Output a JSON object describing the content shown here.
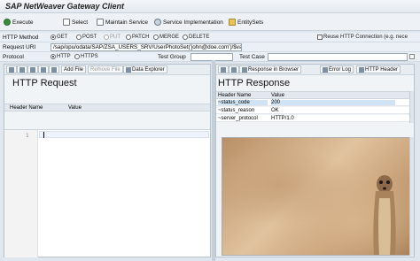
{
  "title": "SAP NetWeaver Gateway Client",
  "toolbar": {
    "execute": "Execute",
    "select": "Select",
    "maintain_service": "Maintain Service",
    "service_implementation": "Service Implementation",
    "entitysets": "EntitySets"
  },
  "method_row": {
    "label": "HTTP Method",
    "get": "GET",
    "post": "POST",
    "put": "PUT",
    "patch": "PATCH",
    "merge": "MERGE",
    "delete": "DELETE",
    "reuse": "Reuse HTTP Connection (e.g. nece"
  },
  "uri_row": {
    "label": "Request URI",
    "value": "/sap/opu/odata/SAP/ZSA_USERS_SRV/UserPhotoSet('john@doe.com')/$value"
  },
  "protocol_row": {
    "label": "Protocol",
    "http": "HTTP",
    "https": "HTTPS",
    "test_group": "Test Group",
    "test_case": "Test Case"
  },
  "request": {
    "add_file": "Add File",
    "remove_file": "Remove File",
    "data_explorer": "Data Explorer",
    "title": "HTTP Request",
    "col_name": "Header Name",
    "col_value": "Value",
    "line_number": "1"
  },
  "response": {
    "in_browser": "Response in Browser",
    "error_log": "Error Log",
    "http_header": "HTTP Header",
    "title": "HTTP Response",
    "col_name": "Header Name",
    "col_value": "Value",
    "rows": [
      {
        "name": "~status_code",
        "value": "200"
      },
      {
        "name": "~status_reason",
        "value": "OK"
      },
      {
        "name": "~server_protocol",
        "value": "HTTP/1.0"
      }
    ]
  }
}
